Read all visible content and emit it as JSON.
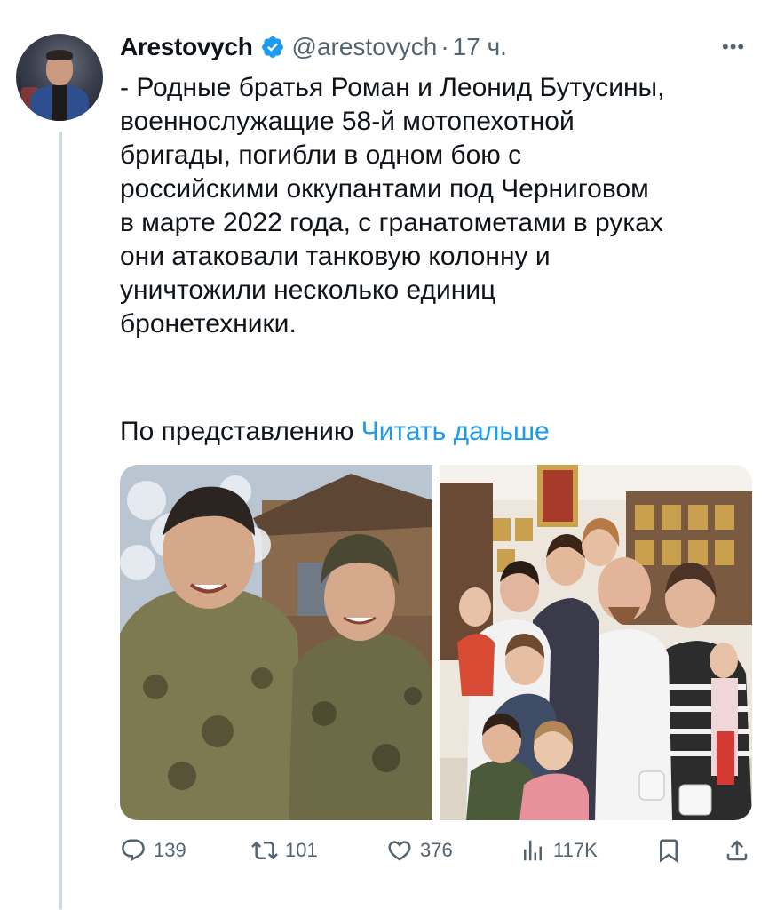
{
  "author": {
    "name": "Arestovych",
    "handle": "@arestovych",
    "separator": "·",
    "time": "17 ч."
  },
  "more_label": "•••",
  "tweet": {
    "lines": [
      "- Родные братья Роман и Леонид Бутусины,",
      "военнослужащие 58-й мотопехотной",
      "бригады, погибли в одном бою с",
      "российскими оккупантами под Черниговом",
      "в марте 2022 года, с гранатометами в руках",
      "они атаковали танковую колонну и",
      "уничтожили несколько единиц",
      "бронетехники."
    ]
  },
  "translation": {
    "prefix": "По представлению",
    "link": "Читать дальше"
  },
  "actions": {
    "replies": "139",
    "reposts": "101",
    "likes": "376",
    "views": "117K"
  },
  "icons": [
    "verified-badge-icon",
    "reply-icon",
    "repost-icon",
    "like-icon",
    "views-icon",
    "bookmark-icon",
    "share-icon"
  ],
  "colors": {
    "link": "#1d9bf0",
    "verified": "#1d9bf0",
    "muted": "#536471",
    "text": "#0f1419"
  }
}
